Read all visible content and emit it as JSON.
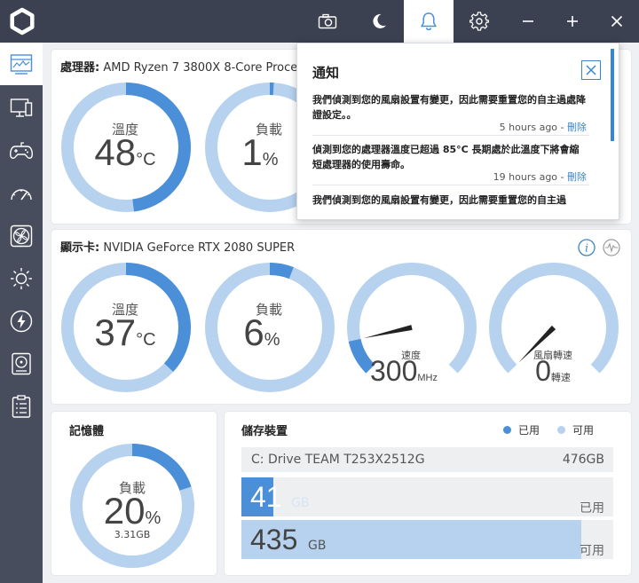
{
  "colors": {
    "accent": "#4a8fd8",
    "track": "#b7d2ee",
    "topbar": "#3b4150",
    "sidebar": "#474d5c"
  },
  "topbar": {
    "icons": [
      "logo-icon",
      "camera-icon",
      "moon-icon",
      "bell-icon",
      "gear-icon",
      "minimize-icon",
      "maximize-icon",
      "close-icon"
    ]
  },
  "sidebar": {
    "items": [
      "dashboard-icon",
      "monitor-icon",
      "gamepad-icon",
      "speedometer-icon",
      "fan-icon",
      "brightness-icon",
      "lightning-icon",
      "storage-disk-icon",
      "clipboard-icon"
    ]
  },
  "cpu": {
    "label_prefix": "處理器:",
    "name": "AMD Ryzen 7 3800X 8-Core Process",
    "temp": {
      "label": "溫度",
      "value": "48",
      "unit": "°C",
      "percent": 48
    },
    "load": {
      "label": "負載",
      "value": "1",
      "unit": "%",
      "percent": 1
    }
  },
  "gpu": {
    "label_prefix": "顯示卡:",
    "name": "NVIDIA GeForce RTX 2080 SUPER",
    "temp": {
      "label": "溫度",
      "value": "37",
      "unit": "°C",
      "percent": 37
    },
    "load": {
      "label": "負載",
      "value": "6",
      "unit": "%",
      "percent": 6
    },
    "clock": {
      "label": "速度",
      "value": "300",
      "unit": "MHz",
      "fraction": 0.12
    },
    "fan": {
      "label": "風扇轉速",
      "value": "0",
      "unit": "轉速",
      "fraction": 0.0
    }
  },
  "memory": {
    "title": "記憶體",
    "label": "負載",
    "value": "20",
    "unit": "%",
    "percent": 20,
    "used": "3.31GB"
  },
  "storage": {
    "title": "儲存裝置",
    "legend_used": "已用",
    "legend_free": "可用",
    "drive_name": "C: Drive TEAM T253X2512G",
    "drive_size": "476GB",
    "used_value": "41",
    "used_unit": "GB",
    "used_label": "已用",
    "used_fraction": 0.086,
    "free_value": "435",
    "free_unit": "GB",
    "free_label": "可用",
    "free_fraction": 0.914
  },
  "notifications": {
    "title": "通知",
    "items": [
      {
        "text": "我們偵測到您的風扇設置有變更，因此需要重置您的自主過處降證設定。。",
        "time": "5 hours ago",
        "sep": " - ",
        "delete": "刪除"
      },
      {
        "text": "偵測到您的處理器溫度已超過 85°C 長期處於此溫度下將會縮短處理器的使用壽命。",
        "time": "19 hours ago",
        "sep": " - ",
        "delete": "刪除"
      },
      {
        "text": "我們偵測到您的風扇設置有變更，因此需要重置您的自主過",
        "time": "",
        "sep": "",
        "delete": ""
      }
    ]
  }
}
